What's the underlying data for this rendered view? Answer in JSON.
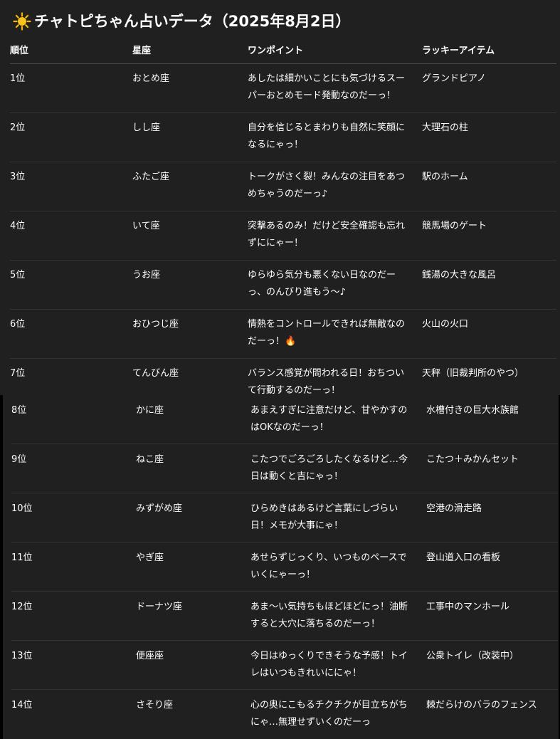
{
  "title": "チャトピちゃん占いデータ（2025年8月2日）",
  "colors": {
    "background": "#202020",
    "text": "#ffffff",
    "separator": "#333333"
  },
  "headers": {
    "rank": "順位",
    "sign": "星座",
    "point": "ワンポイント",
    "item": "ラッキーアイテム"
  },
  "rows_top": [
    {
      "rank": "1位",
      "sign": "おとめ座",
      "point": "あしたは細かいことにも気づけるスーパーおとめモード発動なのだーっ！",
      "item": "グランドピアノ"
    },
    {
      "rank": "2位",
      "sign": "しし座",
      "point": "自分を信じるとまわりも自然に笑顔になるにゃっ！",
      "item": "大理石の柱"
    },
    {
      "rank": "3位",
      "sign": "ふたご座",
      "point": "トークがさく裂！みんなの注目をあつめちゃうのだーっ♪",
      "item": "駅のホーム"
    },
    {
      "rank": "4位",
      "sign": "いて座",
      "point": "突撃あるのみ！だけど安全確認も忘れずににゃー！",
      "item": "競馬場のゲート"
    },
    {
      "rank": "5位",
      "sign": "うお座",
      "point": "ゆらゆら気分も悪くない日なのだーっ、のんびり進もう〜♪",
      "item": "銭湯の大きな風呂"
    },
    {
      "rank": "6位",
      "sign": "おひつじ座",
      "point": "情熱をコントロールできれば無敵なのだーっ！🔥",
      "item": "火山の火口"
    },
    {
      "rank": "7位",
      "sign": "てんびん座",
      "point": "バランス感覚が問われる日！おちついて行動するのだーっ！",
      "item": "天秤（旧裁判所のやつ）"
    }
  ],
  "rows_bottom": [
    {
      "rank": "8位",
      "sign": "かに座",
      "point": "あまえすぎに注意だけど、甘やかすのはOKなのだーっ！",
      "item": "水槽付きの巨大水族館"
    },
    {
      "rank": "9位",
      "sign": "ねこ座",
      "point": "こたつでごろごろしたくなるけど…今日は動くと吉にゃっ！",
      "item": "こたつ＋みかんセット"
    },
    {
      "rank": "10位",
      "sign": "みずがめ座",
      "point": "ひらめきはあるけど言葉にしづらい日！メモが大事にゃ！",
      "item": "空港の滑走路"
    },
    {
      "rank": "11位",
      "sign": "やぎ座",
      "point": "あせらずじっくり、いつものペースでいくにゃーっ！",
      "item": "登山道入口の看板"
    },
    {
      "rank": "12位",
      "sign": "ドーナツ座",
      "point": "あま〜い気持ちもほどほどにっ！油断すると大穴に落ちるのだーっ！",
      "item": "工事中のマンホール"
    },
    {
      "rank": "13位",
      "sign": "便座座",
      "point": "今日はゆっくりできそうな予感！トイレはいつもきれいににゃ！",
      "item": "公衆トイレ（改装中）"
    },
    {
      "rank": "14位",
      "sign": "さそり座",
      "point": "心の奥にこもるチクチクが目立ちがちにゃ…無理せずいくのだーっ",
      "item": "棘だらけのバラのフェンス"
    }
  ]
}
